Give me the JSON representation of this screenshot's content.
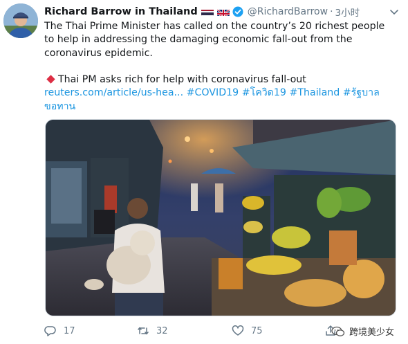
{
  "author": {
    "name": "Richard Barrow in Thailand",
    "handle": "@RichardBarrow",
    "separator": "·",
    "time": "3小时"
  },
  "tweet": {
    "text": "The Thai Prime Minister has called on the country’s 20 richest people to help in addressing the damaging economic fall-out from the coronavirus epidemic.",
    "headline": "Thai PM asks rich for help with coronavirus fall-out",
    "link_text": "reuters.com/article/us-hea...",
    "hashtags": [
      "#COVID19",
      "#โควิด19",
      "#Thailand",
      "#รัฐบาลขอทาน"
    ]
  },
  "actions": {
    "replies": "17",
    "retweets": "32",
    "likes": "75"
  },
  "watermark": {
    "text": "跨境美少女"
  },
  "colors": {
    "link": "#1b95e0",
    "muted": "#657786",
    "verified": "#1da1f2",
    "diamond": "#dd2e44"
  },
  "icons": [
    "flag-thailand-icon",
    "flag-uk-icon",
    "verified-badge-icon",
    "chevron-down-icon",
    "reply-icon",
    "retweet-icon",
    "like-icon",
    "share-icon",
    "wechat-icon"
  ]
}
